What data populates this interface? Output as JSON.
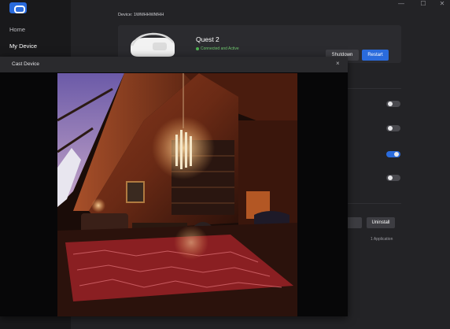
{
  "sidebar": {
    "items": [
      {
        "label": "Home"
      },
      {
        "label": "My Device"
      }
    ]
  },
  "window_controls": {
    "minimize": "—",
    "maximize": "☐",
    "close": "✕"
  },
  "device": {
    "line": "Device: 1WMHHWMHH",
    "name": "Quest 2",
    "status": "Connected and Active",
    "shutdown_label": "Shutdown",
    "restart_label": "Restart"
  },
  "settings_toggles": [
    {
      "state": "off"
    },
    {
      "state": "off"
    },
    {
      "state": "on"
    },
    {
      "state": "off"
    }
  ],
  "apps": {
    "launch_label_visible": "ch",
    "uninstall_label": "Uninstall",
    "count_label": "1 Application"
  },
  "cast": {
    "title": "Cast Device",
    "close_glyph": "×"
  },
  "colors": {
    "accent": "#2a6bdc",
    "status_ok": "#4caf50",
    "background": "#232326",
    "sidebar": "#19191b",
    "card": "#2b2b2f"
  }
}
